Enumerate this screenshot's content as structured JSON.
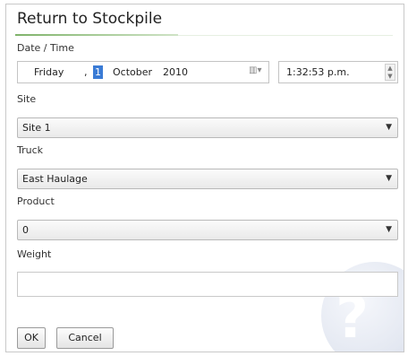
{
  "dialog": {
    "title": "Return to Stockpile"
  },
  "labels": {
    "date_time": "Date / Time",
    "site": "Site",
    "truck": "Truck",
    "product": "Product",
    "weight": "Weight"
  },
  "date": {
    "weekday": "Friday",
    "comma": ",",
    "day": "1",
    "month": "October",
    "year": "2010"
  },
  "time": {
    "value": "1:32:53 p.m."
  },
  "fields": {
    "site": "Site 1",
    "truck": "East Haulage",
    "product": "0",
    "weight": ""
  },
  "buttons": {
    "ok": "OK",
    "cancel": "Cancel"
  },
  "icons": {
    "calendar": "calendar-dropdown-icon",
    "spinner": "time-spinner-icon",
    "dropdown": "chevron-down-icon",
    "help": "help-icon"
  },
  "colors": {
    "title_rule": "#7fb36a",
    "selection": "#3a7bd5"
  }
}
